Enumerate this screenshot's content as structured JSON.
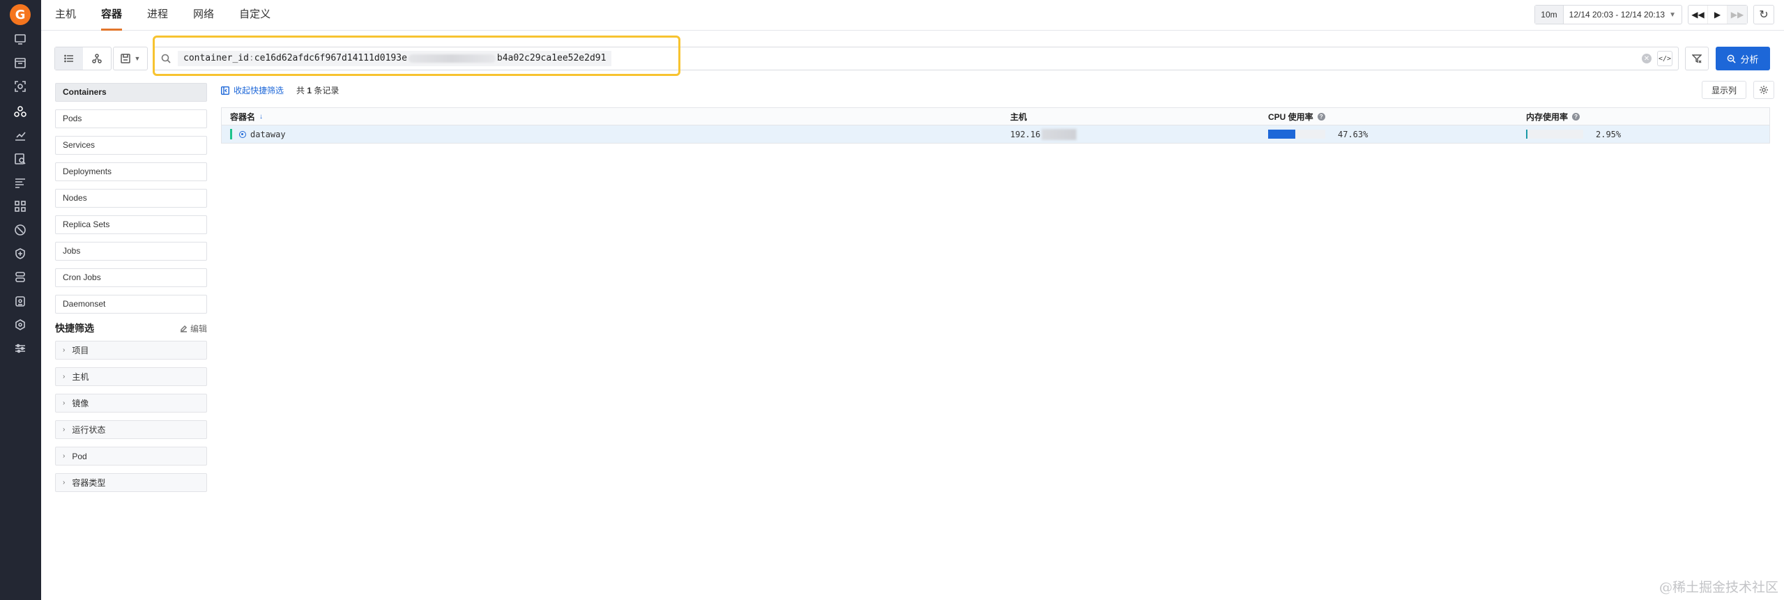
{
  "app": {
    "logo_letter": "G"
  },
  "rail": {
    "items": [
      {
        "icon": "dashboard-icon"
      },
      {
        "icon": "calendar-icon"
      },
      {
        "icon": "scan-icon"
      },
      {
        "icon": "infrastructure-icon",
        "active": true
      },
      {
        "icon": "metrics-icon"
      },
      {
        "icon": "log-search-icon"
      },
      {
        "icon": "list-icon"
      },
      {
        "icon": "apps-icon"
      },
      {
        "icon": "monitor-icon"
      },
      {
        "icon": "shield-icon"
      },
      {
        "icon": "stack-icon"
      },
      {
        "icon": "security-icon"
      },
      {
        "icon": "hexagon-icon"
      },
      {
        "icon": "settings-sliders-icon"
      }
    ]
  },
  "top_tabs": [
    {
      "label": "主机",
      "active": false
    },
    {
      "label": "容器",
      "active": true
    },
    {
      "label": "进程",
      "active": false
    },
    {
      "label": "网络",
      "active": false
    },
    {
      "label": "自定义",
      "active": false
    }
  ],
  "time": {
    "relative": "10m",
    "range": "12/14 20:03 - 12/14 20:13"
  },
  "search": {
    "key": "container_id",
    "separator": ":",
    "value_prefix": "ce16d62afdc6f967d14111d0193e",
    "value_suffix": "b4a02c29ca1ee52e2d91"
  },
  "analyze_label": "分析",
  "sidebar": {
    "items": [
      {
        "label": "Containers",
        "active": true
      },
      {
        "label": "Pods"
      },
      {
        "label": "Services"
      },
      {
        "label": "Deployments"
      },
      {
        "label": "Nodes"
      },
      {
        "label": "Replica Sets"
      },
      {
        "label": "Jobs"
      },
      {
        "label": "Cron Jobs"
      },
      {
        "label": "Daemonset"
      }
    ],
    "quick_filter_title": "快捷筛选",
    "edit_label": "编辑",
    "quick_filters": [
      "项目",
      "主机",
      "镜像",
      "运行状态",
      "Pod",
      "容器类型"
    ]
  },
  "list": {
    "collapse_label": "收起快捷筛选",
    "count_prefix": "共",
    "count": "1",
    "count_suffix": "条记录",
    "columns_button": "显示列",
    "headers": [
      "容器名",
      "主机",
      "CPU 使用率",
      "内存使用率"
    ],
    "rows": [
      {
        "name": "dataway",
        "host": "192.16",
        "cpu_pct": "47.63%",
        "cpu_value": 0.4763,
        "mem_pct": "2.95%",
        "mem_value": 0.0295
      }
    ]
  },
  "colors": {
    "accent": "#e2762c",
    "primary": "#1d67d8",
    "highlight": "#f7c330",
    "status_ok": "#1ec38c",
    "mem_bar": "#1a9aa8"
  },
  "watermark": "@稀土掘金技术社区"
}
